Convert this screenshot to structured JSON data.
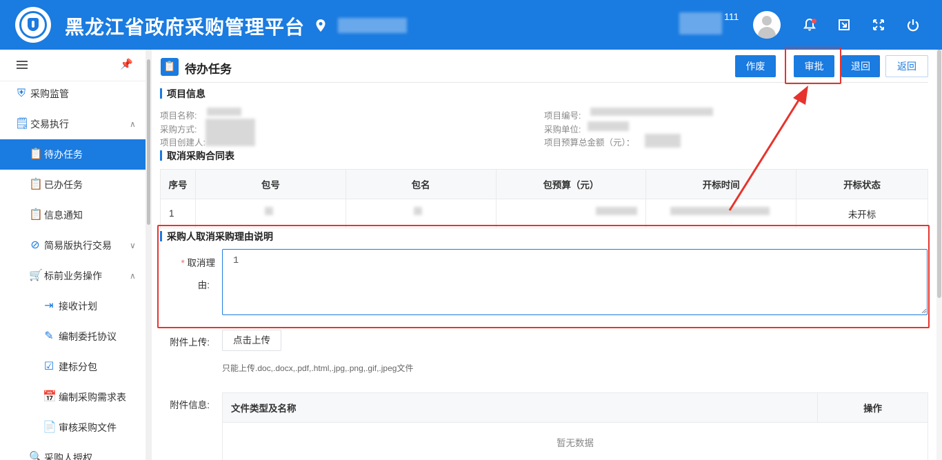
{
  "header": {
    "app_title": "黑龙江省政府采购管理平台",
    "user_suffix": "111",
    "colors": {
      "primary": "#1a7be0",
      "alert": "#e7332d"
    },
    "icons": [
      "location-icon",
      "avatar-icon",
      "bell-icon",
      "window-switch-icon",
      "fullscreen-icon",
      "power-icon"
    ]
  },
  "sidebar": {
    "items": [
      {
        "label": "采购监管",
        "icon": "shield-icon"
      },
      {
        "label": "交易执行",
        "icon": "ledger-icon"
      },
      {
        "label": "待办任务",
        "icon": "task-icon",
        "active": true
      },
      {
        "label": "已办任务",
        "icon": "task-done-icon"
      },
      {
        "label": "信息通知",
        "icon": "notice-icon"
      },
      {
        "label": "简易版执行交易",
        "icon": "simple-trade-icon"
      },
      {
        "label": "标前业务操作",
        "icon": "cart-icon"
      },
      {
        "label": "接收计划",
        "icon": "receive-icon"
      },
      {
        "label": "编制委托协议",
        "icon": "edit-icon"
      },
      {
        "label": "建标分包",
        "icon": "package-icon"
      },
      {
        "label": "编制采购需求表",
        "icon": "form-icon"
      },
      {
        "label": "审核采购文件",
        "icon": "review-icon"
      },
      {
        "label": "采购人授权",
        "icon": "auth-icon"
      }
    ]
  },
  "page": {
    "title": "待办任务",
    "buttons": {
      "void": "作废",
      "approve": "审批",
      "reject": "退回",
      "back": "返回"
    }
  },
  "project_info": {
    "section_title": "项目信息",
    "name_label": "项目名称:",
    "method_label": "采购方式:",
    "creator_label": "项目创建人:",
    "code_label": "项目编号:",
    "unit_label": "采购单位:",
    "budget_label": "项目预算总金额（元）："
  },
  "contract": {
    "section_title": "取消采购合同表",
    "columns": [
      "序号",
      "包号",
      "包名",
      "包预算（元）",
      "开标时间",
      "开标状态"
    ],
    "rows": [
      {
        "index": "1",
        "status": "未开标"
      }
    ]
  },
  "reason": {
    "section_title": "采购人取消采购理由说明",
    "required_mark": "*",
    "label_line1": "取消理",
    "label_line2": "由:",
    "value": "1"
  },
  "attachment": {
    "upload_label": "附件上传:",
    "upload_button": "点击上传",
    "upload_tip": "只能上传.doc,.docx,.pdf,.html,.jpg,.png,.gif,.jpeg文件",
    "info_label": "附件信息:",
    "columns": [
      "文件类型及名称",
      "操作"
    ],
    "empty_text": "暂无数据"
  }
}
